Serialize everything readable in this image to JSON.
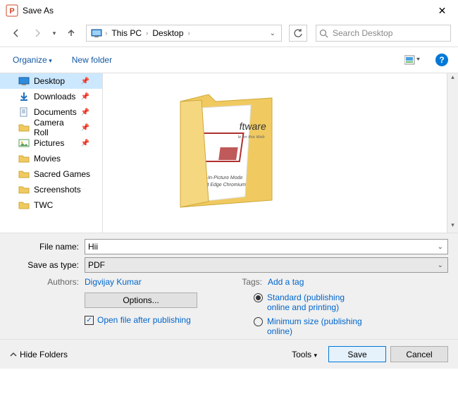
{
  "title": "Save As",
  "breadcrumb": {
    "root": "This PC",
    "folder": "Desktop"
  },
  "search": {
    "placeholder": "Search Desktop"
  },
  "toolbar": {
    "organize": "Organize",
    "newfolder": "New folder"
  },
  "sidebar": {
    "items": [
      {
        "label": "Desktop",
        "icon": "desktop",
        "pinned": true,
        "sel": true
      },
      {
        "label": "Downloads",
        "icon": "downloads",
        "pinned": true
      },
      {
        "label": "Documents",
        "icon": "documents",
        "pinned": true
      },
      {
        "label": "Camera Roll",
        "icon": "folder",
        "pinned": true
      },
      {
        "label": "Pictures",
        "icon": "pictures",
        "pinned": true
      },
      {
        "label": "Movies",
        "icon": "folder"
      },
      {
        "label": "Sacred Games",
        "icon": "folder"
      },
      {
        "label": "Screenshots",
        "icon": "folder"
      },
      {
        "label": "TWC",
        "icon": "folder"
      },
      {
        "label": "",
        "icon": "blank"
      }
    ]
  },
  "filename": {
    "label": "File name:",
    "value": "Hii"
  },
  "savetype": {
    "label": "Save as type:",
    "value": "PDF"
  },
  "authors": {
    "label": "Authors:",
    "value": "Digvijay Kumar"
  },
  "tags": {
    "label": "Tags:",
    "value": "Add a tag"
  },
  "options": {
    "button": "Options...",
    "openafter": "Open file after publishing"
  },
  "radio": {
    "standard": "Standard (publishing online and printing)",
    "minimum": "Minimum size (publishing online)"
  },
  "actions": {
    "hide": "Hide Folders",
    "tools": "Tools",
    "save": "Save",
    "cancel": "Cancel"
  }
}
